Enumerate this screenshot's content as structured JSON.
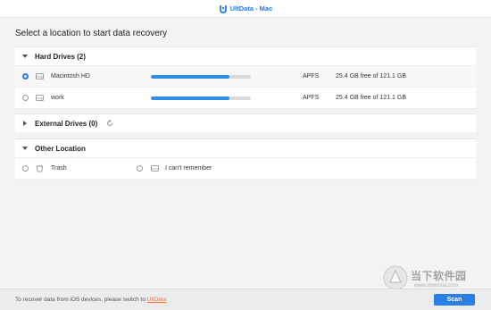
{
  "window": {
    "title": "UltData - Mac"
  },
  "page": {
    "subtitle": "Select a location to start data recovery"
  },
  "hard_drives": {
    "header": "Hard Drives (2)",
    "drives": [
      {
        "name": "Macintosh HD",
        "fs": "APFS",
        "space": "25.4 GB free of 121.1 GB",
        "used_fraction": 0.79,
        "selected": true
      },
      {
        "name": "work",
        "fs": "APFS",
        "space": "25.4 GB free of 121.1 GB",
        "used_fraction": 0.79,
        "selected": false
      }
    ]
  },
  "external_drives": {
    "header": "External Drives (0)"
  },
  "other_location": {
    "header": "Other Location",
    "items": [
      {
        "label": "Trash"
      },
      {
        "label": "I can't remember"
      }
    ]
  },
  "footer": {
    "note": "To recover data from iOS devices, please switch to ",
    "link": "UltData",
    "scan_label": "Scan"
  },
  "watermark": {
    "text": "当下软件园",
    "url": "www.downxia.com"
  },
  "colors": {
    "accent": "#2a7fe4",
    "link": "#e8742a"
  }
}
